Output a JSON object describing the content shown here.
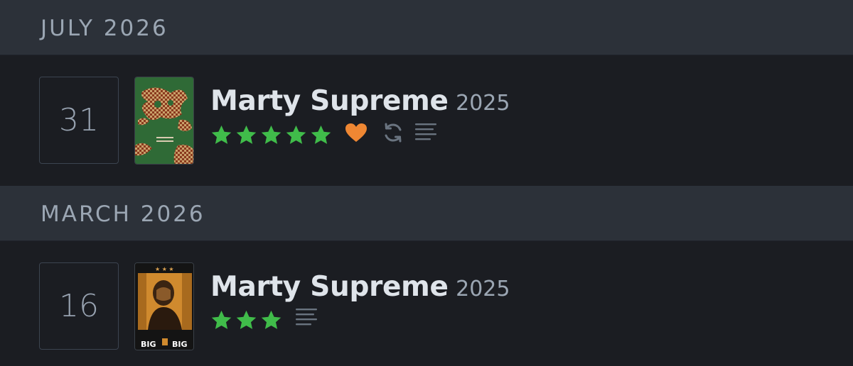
{
  "colors": {
    "star": "#40bc4a",
    "heart": "#ef8733",
    "icon_gray": "#6a7480"
  },
  "diary": [
    {
      "month_label": "JULY 2026",
      "day": "31",
      "title": "Marty Supreme",
      "year": "2025",
      "rating_stars": 5,
      "liked": true,
      "rewatch": true,
      "has_review": true,
      "poster_icon": "marty-supreme-green-poster"
    },
    {
      "month_label": "MARCH 2026",
      "day": "16",
      "title": "Marty Supreme",
      "year": "2025",
      "rating_stars": 3,
      "liked": false,
      "rewatch": false,
      "has_review": true,
      "poster_icon": "marty-supreme-orange-poster"
    }
  ]
}
